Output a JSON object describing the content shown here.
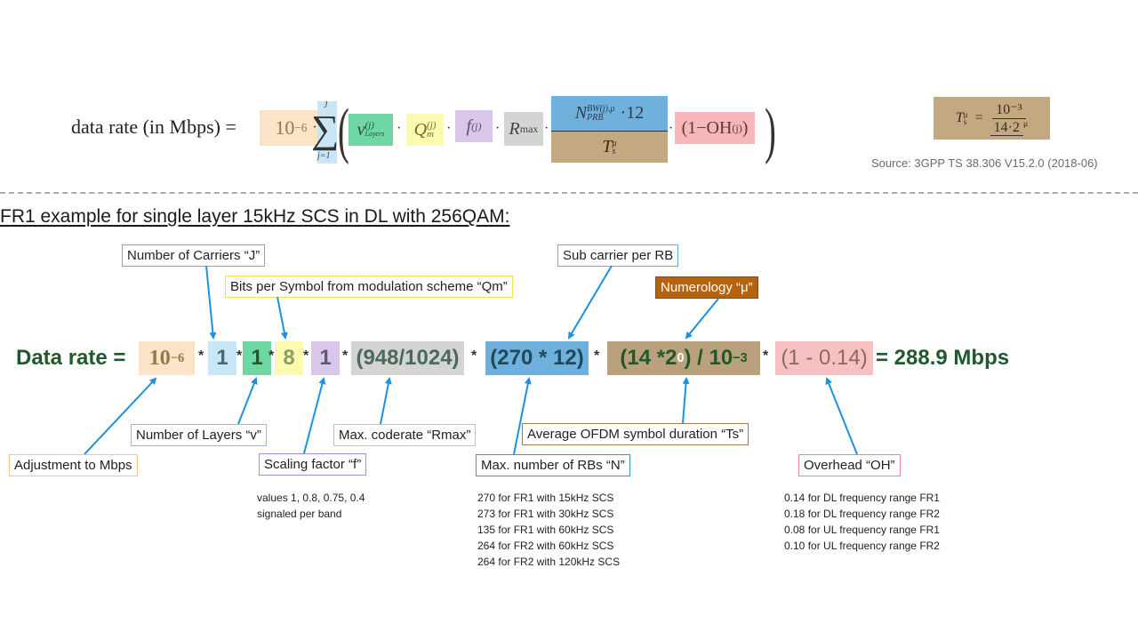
{
  "formula": {
    "label": "data rate (in Mbps) =",
    "scale_term": "10",
    "scale_exp": "−6",
    "sum_upper": "J",
    "sum_lower": "j=1",
    "v_term": "v",
    "v_sup": "(j)",
    "v_sub": "Layers",
    "q_term": "Q",
    "q_sup": "(j)",
    "q_sub": "m",
    "f_term": "f",
    "f_sup": "(j)",
    "r_term": "R",
    "r_sub": "max",
    "n_term": "N",
    "n_sup": "BW(j),μ",
    "n_sub": "PRB",
    "n_mult": "·12",
    "t_term": "T",
    "t_sup": "μ",
    "t_sub": "s",
    "oh_term": "(1−OH",
    "oh_sup": "(j)",
    "oh_close": ")"
  },
  "ts_formula": {
    "lhs": "T",
    "lhs_sup": "μ",
    "lhs_sub": "s",
    "eq": "=",
    "numerator": "10⁻³",
    "denominator": "14·2",
    "denominator_sup": "μ"
  },
  "source": "Source: 3GPP TS 38.306 V15.2.0 (2018-06)",
  "example_title": "FR1 example for single layer 15kHz SCS in DL with 256QAM:",
  "equation": {
    "label": "Data rate =",
    "scale": "10",
    "scale_exp": "−6",
    "op": "*",
    "carriers": "1",
    "layers": "1",
    "bits": "8",
    "scaling": "1",
    "coderate": "(948/1024)",
    "rbs": "(270 * 12)",
    "ofdm_a": "(14 *2",
    "ofdm_exp": "0",
    "ofdm_b": ") / 10",
    "ofdm_exp2": "−3",
    "overhead": "(1 - 0.14)",
    "result": "= 288.9 Mbps"
  },
  "callouts": {
    "carriers": "Number of Carriers “J”",
    "bits": "Bits per Symbol from modulation scheme “Qm”",
    "subcarrier": "Sub carrier per RB",
    "numerology": "Numerology “μ”",
    "layers": "Number of Layers “v”",
    "adjust": "Adjustment to Mbps",
    "scaling": "Scaling factor “f”",
    "rmax": "Max. coderate “Rmax”",
    "rbs": "Max. number of RBs “N”",
    "ofdm": "Average OFDM symbol duration “Ts”",
    "overhead": "Overhead “OH”"
  },
  "notes": {
    "scaling": [
      "values 1, 0.8, 0.75, 0.4",
      "signaled per band"
    ],
    "rbs": [
      "270 for FR1 with 15kHz SCS",
      "273 for FR1 with 30kHz SCS",
      "135 for FR1 with 60kHz SCS",
      "264 for FR2 with 60kHz SCS",
      "264 for FR2 with 120kHz SCS"
    ],
    "overhead": [
      "0.14 for DL frequency range FR1",
      "0.18 for DL frequency range FR2",
      "0.08 for UL frequency range FR1",
      "0.10 for UL frequency range FR2"
    ]
  },
  "colors": {
    "scale": "#fbe3c8",
    "carriers": "#c9e6f7",
    "layers": "#6fd7a3",
    "bits": "#fdf9b0",
    "scaling": "#d9c6ea",
    "coderate": "#d4d4d4",
    "rbs": "#6fb1dc",
    "ofdm": "#b8a17c",
    "overhead": "#f7c1c3",
    "numerology": "#b5630f",
    "result_text": "#1f5a2a",
    "arrow": "#1e90e0"
  }
}
